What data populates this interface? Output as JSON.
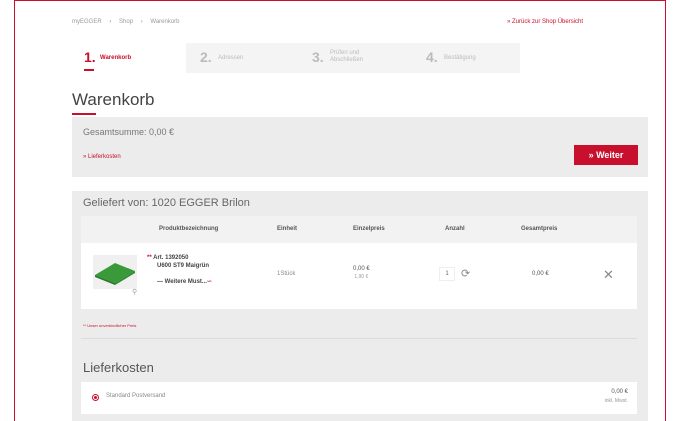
{
  "breadcrumb": [
    "myEGGER",
    "Shop",
    "Warenkorb"
  ],
  "back_link": "» Zurück zur Shop Übersicht",
  "steps": [
    {
      "num": "1.",
      "label": "Warenkorb"
    },
    {
      "num": "2.",
      "label": "Adressen"
    },
    {
      "num": "3.",
      "label": "Prüfen und Abschließen"
    },
    {
      "num": "4.",
      "label": "Bestätigung"
    }
  ],
  "page_title": "Warenkorb",
  "summary": {
    "label": "Gesamtsumme: 0,00 €",
    "shipping_link": "» Lieferkosten",
    "next_button": "» Weiter"
  },
  "order": {
    "supplier": "Geliefert von: 1020 EGGER Brilon",
    "columns": [
      "Produktbezeichnung",
      "Einheit",
      "Einzelpreis",
      "Anzahl",
      "Gesamtpreis"
    ],
    "row": {
      "article": "Art. 1392050",
      "name": "U600 ST9 Maigrün",
      "more": "— Weitere Must...",
      "unit": "1Stück",
      "price": "0,00 €",
      "old_price": "1,90 €",
      "qty": "1",
      "total": "0,00 €"
    },
    "footnote": "** Unser unverbindlicher Preis"
  },
  "shipping": {
    "title": "Lieferkosten",
    "option": "Standard Postversand",
    "price": "0,00 €",
    "vat": "inkl. Mwst."
  },
  "colors": {
    "accent": "#c8102e",
    "panel": "#ececec",
    "swatch": "#3a9a3a"
  },
  "icons": [
    "search-icon",
    "reload-icon",
    "close-icon",
    "radio-selected-icon"
  ]
}
